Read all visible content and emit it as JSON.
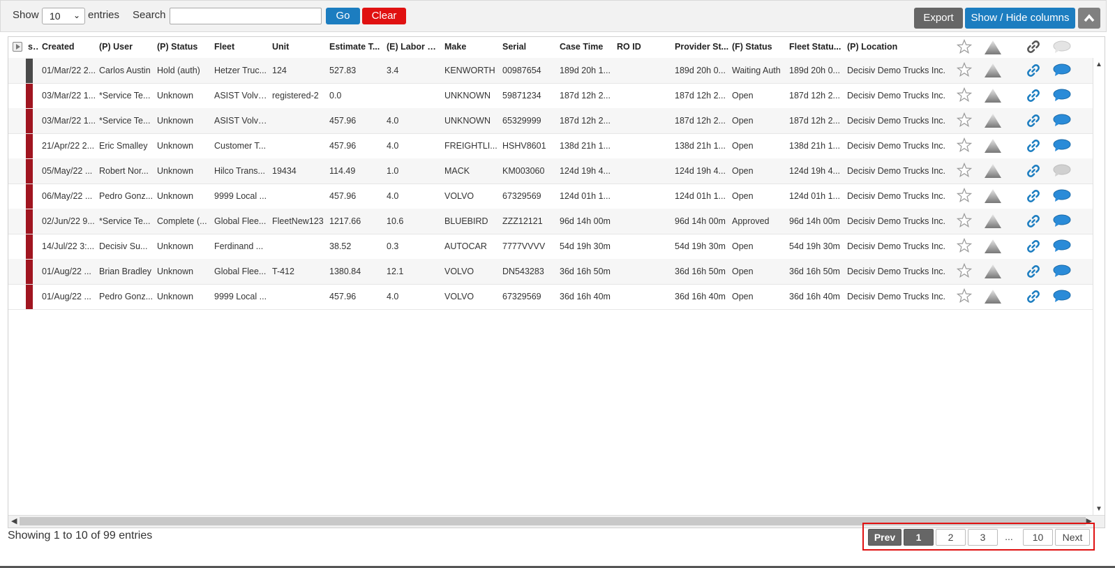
{
  "toolbar": {
    "show_label": "Show",
    "entries_value": "10",
    "entries_label": "entries",
    "search_label": "Search",
    "search_value": "",
    "go_label": "Go",
    "clear_label": "Clear",
    "export_label": "Export",
    "showhide_label": "Show / Hide columns"
  },
  "columns": [
    "sta",
    "Created",
    "(P) User",
    "(P) Status",
    "Fleet",
    "Unit",
    "Estimate T...",
    "(E) Labor Hrs",
    "Make",
    "Serial",
    "Case Time",
    "RO ID",
    "Provider St...",
    "(F) Status",
    "Fleet Statu...",
    "(P) Location"
  ],
  "rows": [
    {
      "status_color": "#4a4a4a",
      "created": "01/Mar/22 2...",
      "user": "Carlos Austin",
      "pstatus": "Hold (auth)",
      "fleet": "Hetzer Truc...",
      "unit": "124",
      "estimate": "527.83",
      "labor": "3.4",
      "make": "KENWORTH",
      "serial": "00987654",
      "casetime": "189d 20h 1...",
      "roid": "",
      "provider": "189d 20h 0...",
      "fstatus": "Waiting Auth",
      "fleetstatus": "189d 20h 0...",
      "location": "Decisiv Demo Trucks Inc.",
      "comment_active": true
    },
    {
      "status_color": "#a01520",
      "created": "03/Mar/22 1...",
      "user": "*Service Te...",
      "pstatus": "Unknown",
      "fleet": "ASIST Volvo...",
      "unit": "registered-2",
      "estimate": "0.0",
      "labor": "",
      "make": "UNKNOWN",
      "serial": "59871234",
      "casetime": "187d 12h 2...",
      "roid": "",
      "provider": "187d 12h 2...",
      "fstatus": "Open",
      "fleetstatus": "187d 12h 2...",
      "location": "Decisiv Demo Trucks Inc.",
      "comment_active": true
    },
    {
      "status_color": "#a01520",
      "created": "03/Mar/22 1...",
      "user": "*Service Te...",
      "pstatus": "Unknown",
      "fleet": "ASIST Volvo...",
      "unit": "",
      "estimate": "457.96",
      "labor": "4.0",
      "make": "UNKNOWN",
      "serial": "65329999",
      "casetime": "187d 12h 2...",
      "roid": "",
      "provider": "187d 12h 2...",
      "fstatus": "Open",
      "fleetstatus": "187d 12h 2...",
      "location": "Decisiv Demo Trucks Inc.",
      "comment_active": true
    },
    {
      "status_color": "#a01520",
      "created": "21/Apr/22 2...",
      "user": "Eric Smalley",
      "pstatus": "Unknown",
      "fleet": "Customer T...",
      "unit": "",
      "estimate": "457.96",
      "labor": "4.0",
      "make": "FREIGHTLI...",
      "serial": "HSHV8601",
      "casetime": "138d 21h 1...",
      "roid": "",
      "provider": "138d 21h 1...",
      "fstatus": "Open",
      "fleetstatus": "138d 21h 1...",
      "location": "Decisiv Demo Trucks Inc.",
      "comment_active": true
    },
    {
      "status_color": "#a01520",
      "created": "05/May/22 ...",
      "user": "Robert Nor...",
      "pstatus": "Unknown",
      "fleet": "Hilco Trans...",
      "unit": "19434",
      "estimate": "114.49",
      "labor": "1.0",
      "make": "MACK",
      "serial": "KM003060",
      "casetime": "124d 19h 4...",
      "roid": "",
      "provider": "124d 19h 4...",
      "fstatus": "Open",
      "fleetstatus": "124d 19h 4...",
      "location": "Decisiv Demo Trucks Inc.",
      "comment_active": false
    },
    {
      "status_color": "#a01520",
      "created": "06/May/22 ...",
      "user": "Pedro Gonz...",
      "pstatus": "Unknown",
      "fleet": "9999 Local ...",
      "unit": "",
      "estimate": "457.96",
      "labor": "4.0",
      "make": "VOLVO",
      "serial": "67329569",
      "casetime": "124d 01h 1...",
      "roid": "",
      "provider": "124d 01h 1...",
      "fstatus": "Open",
      "fleetstatus": "124d 01h 1...",
      "location": "Decisiv Demo Trucks Inc.",
      "comment_active": true
    },
    {
      "status_color": "#a01520",
      "created": "02/Jun/22 9...",
      "user": "*Service Te...",
      "pstatus": "Complete (...",
      "fleet": "Global Flee...",
      "unit": "FleetNew123",
      "estimate": "1217.66",
      "labor": "10.6",
      "make": "BLUEBIRD",
      "serial": "ZZZ12121",
      "casetime": "96d 14h 00m",
      "roid": "",
      "provider": "96d 14h 00m",
      "fstatus": "Approved",
      "fleetstatus": "96d 14h 00m",
      "location": "Decisiv Demo Trucks Inc.",
      "comment_active": true
    },
    {
      "status_color": "#a01520",
      "created": "14/Jul/22 3:...",
      "user": "Decisiv Su...",
      "pstatus": "Unknown",
      "fleet": "Ferdinand ...",
      "unit": "",
      "estimate": "38.52",
      "labor": "0.3",
      "make": "AUTOCAR",
      "serial": "7777VVVV",
      "casetime": "54d 19h 30m",
      "roid": "",
      "provider": "54d 19h 30m",
      "fstatus": "Open",
      "fleetstatus": "54d 19h 30m",
      "location": "Decisiv Demo Trucks Inc.",
      "comment_active": true
    },
    {
      "status_color": "#a01520",
      "created": "01/Aug/22 ...",
      "user": "Brian Bradley",
      "pstatus": "Unknown",
      "fleet": "Global Flee...",
      "unit": "T-412",
      "estimate": "1380.84",
      "labor": "12.1",
      "make": "VOLVO",
      "serial": "DN543283",
      "casetime": "36d 16h 50m",
      "roid": "",
      "provider": "36d 16h 50m",
      "fstatus": "Open",
      "fleetstatus": "36d 16h 50m",
      "location": "Decisiv Demo Trucks Inc.",
      "comment_active": true
    },
    {
      "status_color": "#a01520",
      "created": "01/Aug/22 ...",
      "user": "Pedro Gonz...",
      "pstatus": "Unknown",
      "fleet": "9999 Local ...",
      "unit": "",
      "estimate": "457.96",
      "labor": "4.0",
      "make": "VOLVO",
      "serial": "67329569",
      "casetime": "36d 16h 40m",
      "roid": "",
      "provider": "36d 16h 40m",
      "fstatus": "Open",
      "fleetstatus": "36d 16h 40m",
      "location": "Decisiv Demo Trucks Inc.",
      "comment_active": true
    }
  ],
  "icons": {
    "star": "star-icon",
    "priority": "triangle-icon",
    "link": "link-icon",
    "comment": "comment-icon"
  },
  "colors": {
    "link_blue": "#1c7dc0",
    "comment_blue": "#2a8bd8",
    "comment_grey": "#d0d0d0",
    "clear_red": "#e01111"
  },
  "footer": {
    "summary": "Showing 1 to 10 of 99 entries"
  },
  "pager": {
    "prev": "Prev",
    "pages": [
      "1",
      "2",
      "3"
    ],
    "ellipsis": "...",
    "last": "10",
    "next": "Next",
    "current": "1"
  }
}
